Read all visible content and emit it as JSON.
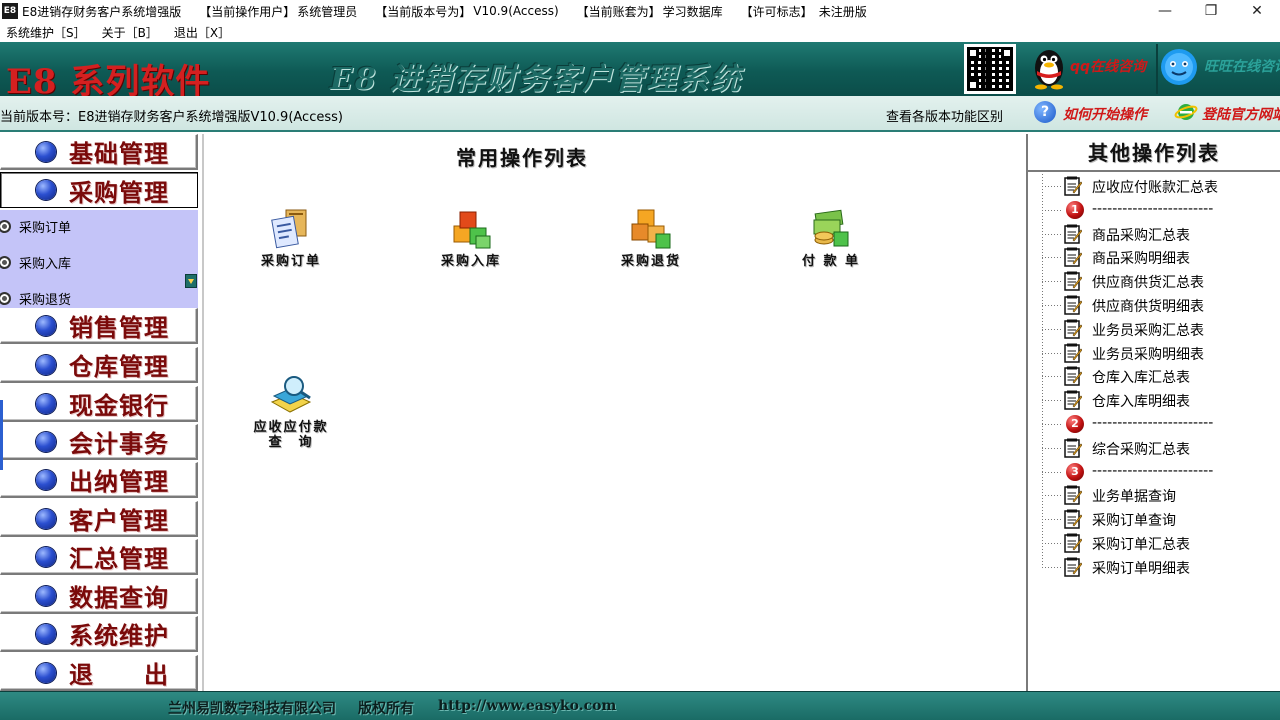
{
  "titlebar": {
    "app_icon_text": "E8",
    "app_name": "E8进销存财务客户系统增强版",
    "current_user_label": "【当前操作用户】",
    "current_user": "系统管理员",
    "version_label": "【当前版本号为】",
    "version": "V10.9(Access)",
    "account_label": "【当前账套为】",
    "account": "学习数据库",
    "license_label": "【许可标志】",
    "license": "未注册版",
    "minimize": "—",
    "restore": "❐",
    "close": "✕"
  },
  "menubar": {
    "items": [
      "系统维护［S］",
      "关于［B］",
      "退出［X］"
    ]
  },
  "banner": {
    "brand": "E8 系列软件",
    "title": "E8 进销存财务客户管理系统",
    "qq_link_1": "qq在线咨询",
    "qq_link_2": "旺旺在线咨询"
  },
  "versionbar": {
    "version_text": "当前版本号：E8进销存财务客户系统增强版V10.9(Access)",
    "compare_link": "查看各版本功能区别",
    "howto_link": "如何开始操作",
    "site_link": "登陆官方网站"
  },
  "leftnav": {
    "items": [
      "基础管理",
      "采购管理",
      "销售管理",
      "仓库管理",
      "现金银行",
      "会计事务",
      "出纳管理",
      "客户管理",
      "汇总管理",
      "数据查询",
      "系统维护",
      "退　　出"
    ],
    "sub_items": [
      "采购订单",
      "采购入库",
      "采购退货"
    ]
  },
  "center": {
    "title": "常用操作列表",
    "tiles": [
      "采购订单",
      "采购入库",
      "采购退货",
      "付 款 单",
      "应收应付款\n查　询"
    ]
  },
  "right": {
    "title": "其他操作列表",
    "items": [
      {
        "type": "doc",
        "label": "应收应付账款汇总表"
      },
      {
        "type": "num",
        "num": "1",
        "label": "------------------------"
      },
      {
        "type": "doc",
        "label": "商品采购汇总表"
      },
      {
        "type": "doc",
        "label": "商品采购明细表"
      },
      {
        "type": "doc",
        "label": "供应商供货汇总表"
      },
      {
        "type": "doc",
        "label": "供应商供货明细表"
      },
      {
        "type": "doc",
        "label": "业务员采购汇总表"
      },
      {
        "type": "doc",
        "label": "业务员采购明细表"
      },
      {
        "type": "doc",
        "label": "仓库入库汇总表"
      },
      {
        "type": "doc",
        "label": "仓库入库明细表"
      },
      {
        "type": "num",
        "num": "2",
        "label": "------------------------"
      },
      {
        "type": "doc",
        "label": "综合采购汇总表"
      },
      {
        "type": "num",
        "num": "3",
        "label": "------------------------"
      },
      {
        "type": "doc",
        "label": "业务单据查询"
      },
      {
        "type": "doc",
        "label": "采购订单查询"
      },
      {
        "type": "doc",
        "label": "采购订单汇总表"
      },
      {
        "type": "doc",
        "label": "采购订单明细表"
      }
    ]
  },
  "footer": {
    "company": "兰州易凯数字科技有限公司",
    "rights": "版权所有",
    "url": "http://www.easyko.com"
  },
  "colors": {
    "banner": "#0e5a55",
    "brand_red": "#d42020",
    "nav_text": "#7a0a0a",
    "sub_panel": "#c4c4f8"
  }
}
